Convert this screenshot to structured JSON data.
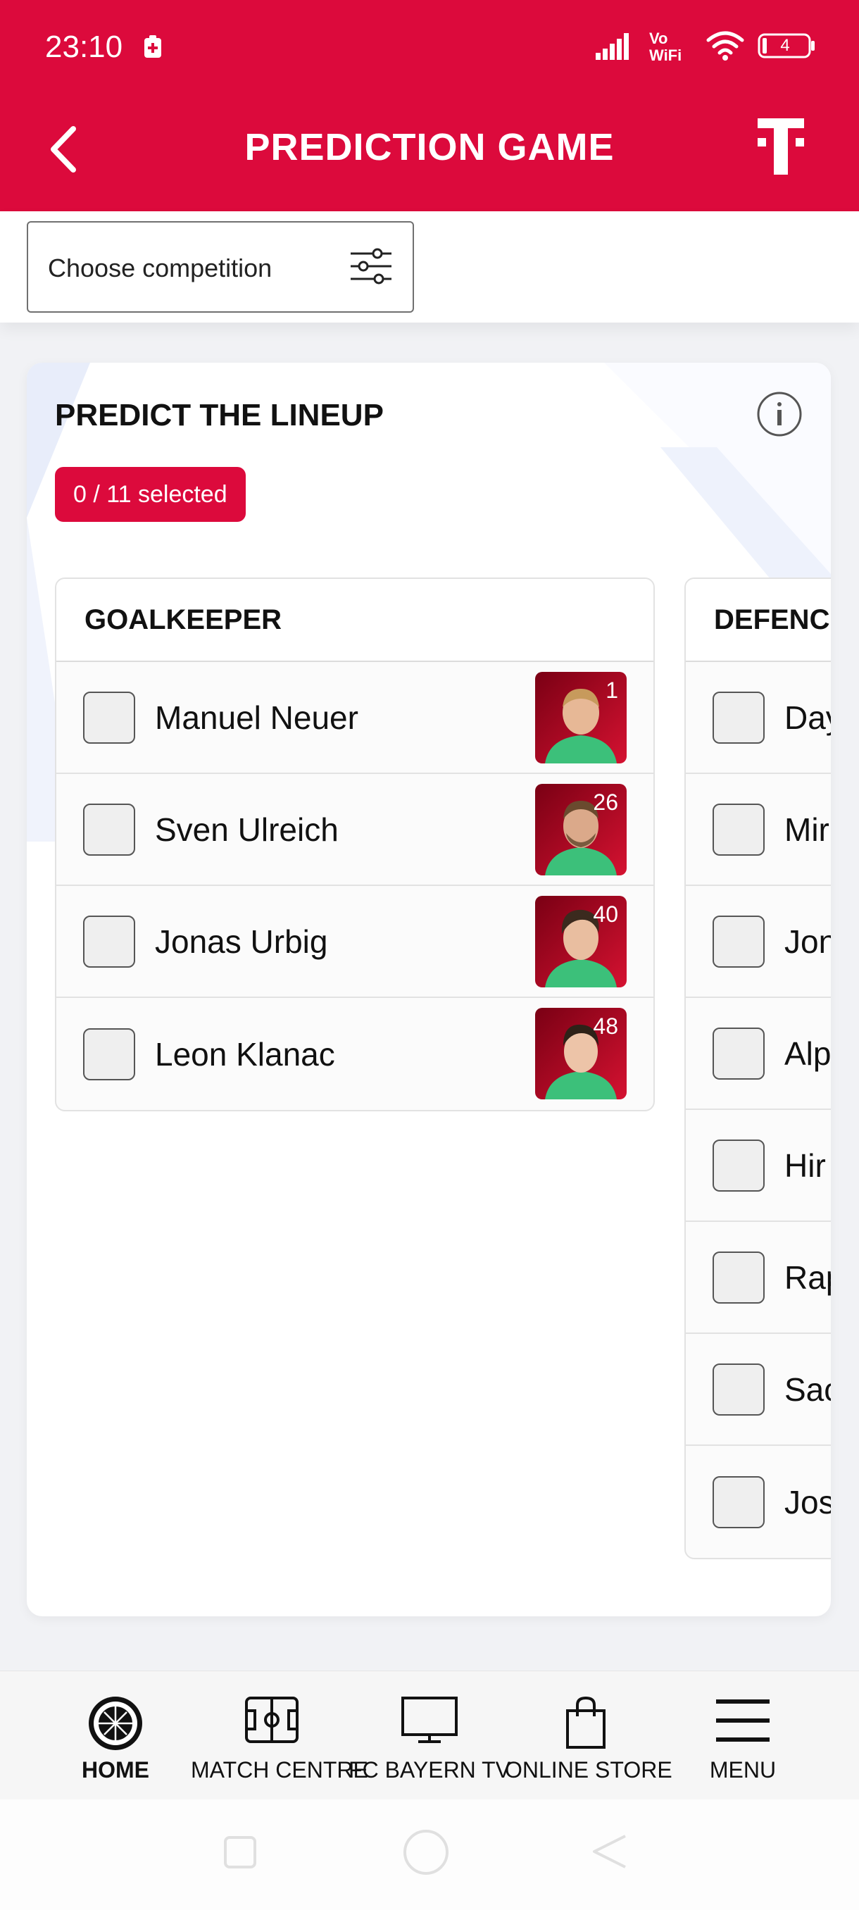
{
  "status_bar": {
    "time": "23:10",
    "network": "Vo WiFi",
    "battery": "4"
  },
  "header": {
    "title": "PREDICTION GAME"
  },
  "filter": {
    "label": "Choose competition"
  },
  "card": {
    "title": "PREDICT THE LINEUP",
    "selected": "0 / 11 selected"
  },
  "goalkeeper": {
    "title": "GOALKEEPER",
    "players": [
      {
        "name": "Manuel Neuer",
        "number": "1"
      },
      {
        "name": "Sven Ulreich",
        "number": "26"
      },
      {
        "name": "Jonas Urbig",
        "number": "40"
      },
      {
        "name": "Leon Klanac",
        "number": "48"
      }
    ]
  },
  "defence": {
    "title": "DEFENCE",
    "players": [
      {
        "name": "Day"
      },
      {
        "name": "Mir"
      },
      {
        "name": "Jon"
      },
      {
        "name": "Alp"
      },
      {
        "name": "Hir"
      },
      {
        "name": "Rap"
      },
      {
        "name": "Sac"
      },
      {
        "name": "Jos"
      }
    ]
  },
  "bottom_nav": {
    "items": [
      {
        "label": "HOME",
        "icon": "fc-bayern-crest-icon"
      },
      {
        "label": "MATCH CENTRE",
        "icon": "pitch-icon"
      },
      {
        "label": "FC BAYERN TV",
        "icon": "tv-icon"
      },
      {
        "label": "ONLINE STORE",
        "icon": "shopping-bag-icon"
      },
      {
        "label": "MENU",
        "icon": "hamburger-menu-icon"
      }
    ]
  },
  "colors": {
    "brand_red": "#dc0a3c",
    "photo_red": "#c8102e",
    "jersey_green": "#3cc07a"
  }
}
